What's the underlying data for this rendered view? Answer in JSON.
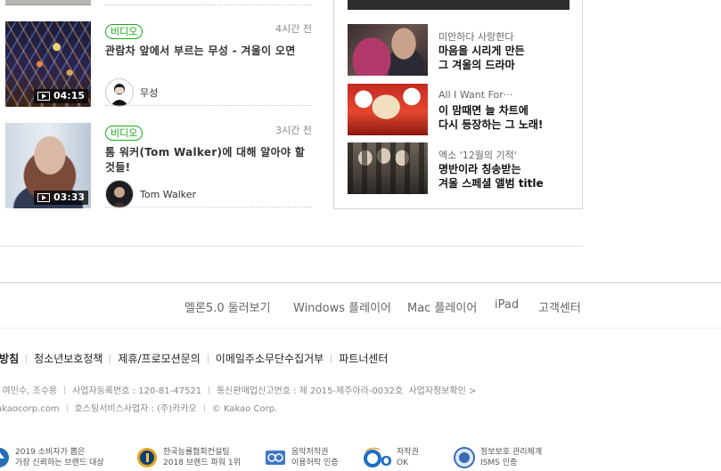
{
  "feed": {
    "items": [
      {
        "badge": "비디오",
        "ago": "4시간 전",
        "title": "관람차 앞에서 부르는 무성 - 겨울이 오면",
        "duration": "04:15",
        "artist": "무성"
      },
      {
        "badge": "비디오",
        "ago": "3시간 전",
        "title": "톰 워커(Tom Walker)에 대해 알아야 할 것들!",
        "duration": "03:33",
        "artist": "Tom Walker"
      }
    ]
  },
  "magazine": {
    "items": [
      {
        "sub": "미안하다 사랑한다",
        "title_line1": "마음을 시리게 만든",
        "title_line2": "그 겨울의 드라마"
      },
      {
        "sub": "All I Want For···",
        "title_line1": "이 맘때면 늘 차트에",
        "title_line2": "다시 등장하는 그 노래!"
      },
      {
        "sub": "엑소 '12월의 기적'",
        "title_line1": "명반이라 칭송받는",
        "title_line2": "겨울 스페셜 앨범 title"
      }
    ]
  },
  "footer": {
    "nav": [
      "멜론5.0 둘러보기",
      "Windows 플레이어",
      "Mac 플레이어",
      "iPad",
      "고객센터"
    ],
    "links": [
      "리방침",
      "청소년보호정책",
      "제휴/프로모션문의",
      "이메일주소무단수집거부",
      "파트너센터"
    ],
    "info_line1": {
      "a": ": 여민수, 조수용",
      "b": "사업자등록번호 : 120-81-47521",
      "c": "통신판매업신고번호 : 제 2015-제주아라-0032호",
      "d": "사업자정보확인 >"
    },
    "info_line2": {
      "a": "akaocorp.com",
      "b": "호스팅서비스사업자 : (주)카카오",
      "c": "© Kakao Corp."
    },
    "certs": [
      {
        "line1": "2019 소비자가 뽑은",
        "line2": "가장 신뢰하는 브랜드 대상"
      },
      {
        "line1": "한국능률협회컨설팅",
        "line2": "2018 브랜드 파워 1위"
      },
      {
        "line1": "음악저작권",
        "line2": "이용허락 인증"
      },
      {
        "line1": "저작권",
        "line2": "OK"
      },
      {
        "line1": "정보보호 관리체계",
        "line2": "ISMS 인증"
      }
    ],
    "cert_ok_mark": "OK"
  },
  "colors": {
    "badge_green": "#1aab1a",
    "link_gray": "#666666"
  }
}
